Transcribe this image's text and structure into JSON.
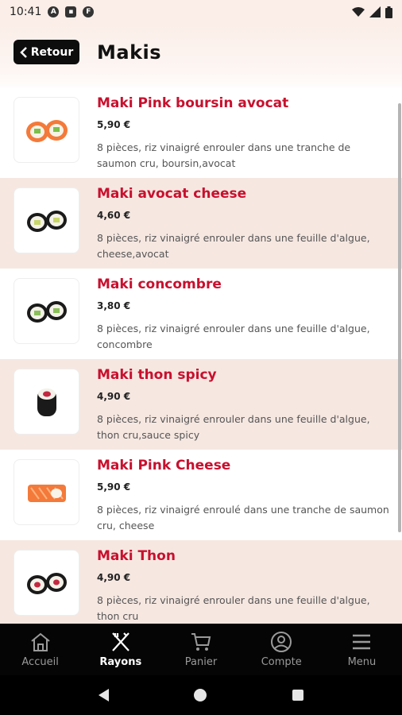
{
  "status_bar": {
    "time": "10:41"
  },
  "header": {
    "back_label": "Retour",
    "title": "Makis"
  },
  "items": [
    {
      "name": "Maki Pink boursin avocat",
      "price": "5,90 €",
      "description": "8 pièces, riz vinaigré enrouler dans une tranche de saumon cru, boursin,avocat",
      "thumb": "salmon-maki"
    },
    {
      "name": "Maki avocat cheese",
      "price": "4,60 €",
      "description": "8 pièces, riz vinaigré enrouler dans une feuille d'algue, cheese,avocat",
      "thumb": "nori-maki"
    },
    {
      "name": "Maki concombre",
      "price": "3,80 €",
      "description": "8 pièces, riz vinaigré enrouler dans une feuille d'algue, concombre",
      "thumb": "nori-maki"
    },
    {
      "name": "Maki thon spicy",
      "price": "4,90 €",
      "description": "8 pièces, riz vinaigré enrouler dans une feuille d'algue, thon cru,sauce spicy",
      "thumb": "nori-maki-tuna"
    },
    {
      "name": "Maki Pink Cheese",
      "price": "5,90 €",
      "description": "8 pièces, riz vinaigré enroulé dans une tranche de saumon cru, cheese",
      "thumb": "salmon-maki-side"
    },
    {
      "name": "Maki Thon",
      "price": "4,90 €",
      "description": "8 pièces, riz vinaigré enrouler dans une feuille d'algue, thon cru",
      "thumb": "nori-maki-tuna"
    }
  ],
  "bottom_nav": [
    {
      "label": "Accueil",
      "icon": "home-icon",
      "active": false
    },
    {
      "label": "Rayons",
      "icon": "utensils-icon",
      "active": true
    },
    {
      "label": "Panier",
      "icon": "cart-icon",
      "active": false
    },
    {
      "label": "Compte",
      "icon": "account-icon",
      "active": false
    },
    {
      "label": "Menu",
      "icon": "menu-icon",
      "active": false
    }
  ],
  "colors": {
    "accent": "#c8102e",
    "background": "#fbeee8",
    "alt_row": "#f6e7e1",
    "nav_bg": "#050505"
  }
}
